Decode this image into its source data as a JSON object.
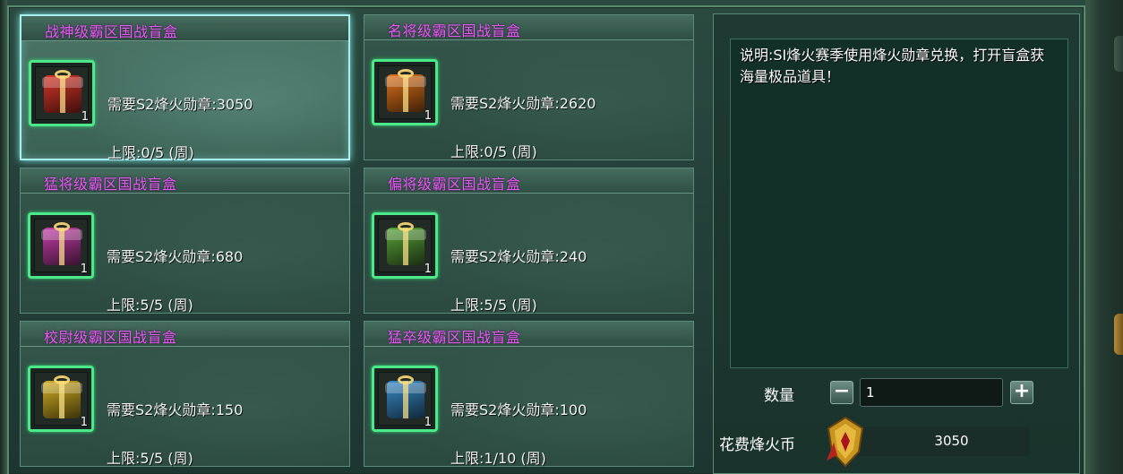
{
  "cards": [
    {
      "title": "战神级霸区国战盲盒",
      "need": "需要S2烽火勋章:3050",
      "limit": "上限:0/5 (周)",
      "count": "1",
      "color": "#d8362a",
      "icon": "red-gift-box-icon",
      "selected": true
    },
    {
      "title": "名将级霸区国战盲盒",
      "need": "需要S2烽火勋章:2620",
      "limit": "上限:0/5 (周)",
      "count": "1",
      "color": "#e0741c",
      "icon": "orange-gift-box-icon",
      "selected": false
    },
    {
      "title": "猛将级霸区国战盲盒",
      "need": "需要S2烽火勋章:680",
      "limit": "上限:5/5 (周)",
      "count": "1",
      "color": "#c43fa8",
      "icon": "purple-gift-box-icon",
      "selected": false
    },
    {
      "title": "偏将级霸区国战盲盒",
      "need": "需要S2烽火勋章:240",
      "limit": "上限:5/5 (周)",
      "count": "1",
      "color": "#5aa33a",
      "icon": "green-gift-box-icon",
      "selected": false
    },
    {
      "title": "校尉级霸区国战盲盒",
      "need": "需要S2烽火勋章:150",
      "limit": "上限:5/5 (周)",
      "count": "1",
      "color": "#d4b024",
      "icon": "yellow-gift-box-icon",
      "selected": false
    },
    {
      "title": "猛卒级霸区国战盲盒",
      "need": "需要S2烽火勋章:100",
      "limit": "上限:1/10 (周)",
      "count": "1",
      "color": "#3a8cc8",
      "icon": "blue-gift-box-icon",
      "selected": false
    }
  ],
  "panel": {
    "description": "说明:SI烽火赛季使用烽火勋章兑换，打开盲盒获海量极品道具！",
    "quantity_label": "数量",
    "quantity_value": "1",
    "minus_label": "−",
    "plus_label": "+",
    "cost_label": "花费烽火币",
    "cost_value": "3050",
    "cost_icon": "medal-icon"
  }
}
